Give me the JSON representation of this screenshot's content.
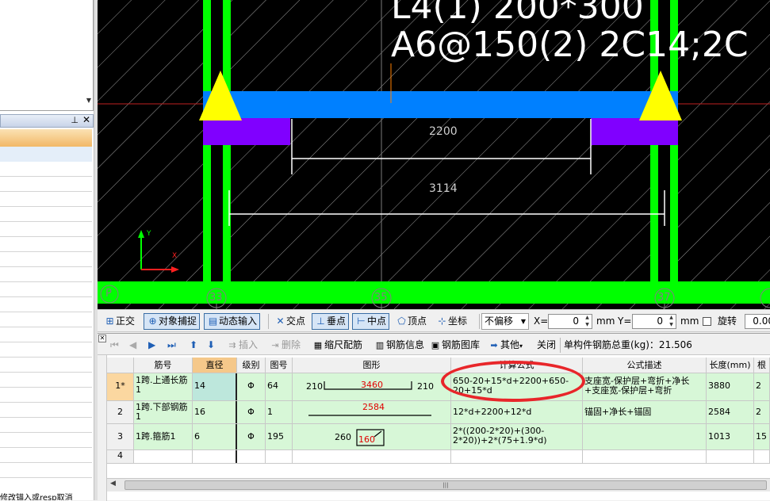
{
  "cad": {
    "line1": "L4(1) 200*300",
    "line2": "A6@150(2) 2C14;2C",
    "dim_inner": "2200",
    "dim_outer": "3114",
    "axis_y": "Y",
    "axis_x": "X",
    "grid_p": "P",
    "grid_33": "33",
    "grid_35": "35",
    "grid_37": "37"
  },
  "toolbar": {
    "ortho": "正交",
    "snap": "对象捕捉",
    "dynamic": "动态输入",
    "intersect": "交点",
    "perp": "垂点",
    "mid": "中点",
    "vertex": "顶点",
    "coord": "坐标",
    "offset": "不偏移",
    "x_label": "X=",
    "x_value": "0",
    "mm1": "mm",
    "y_label": "Y=",
    "y_value": "0",
    "mm2": "mm",
    "rotate": "旋转",
    "rotate_value": "0.00"
  },
  "rebar_toolbar": {
    "insert": "插入",
    "delete": "删除",
    "scale": "缩尺配筋",
    "info": "钢筋信息",
    "library": "钢筋图库",
    "other": "其他",
    "close": "关闭",
    "total": "单构件钢筋总重(kg)：21.506"
  },
  "table": {
    "headers": [
      "筋号",
      "直径(mm)",
      "级别",
      "图号",
      "图形",
      "计算公式",
      "公式描述",
      "长度(mm)",
      "根数"
    ],
    "rows": [
      {
        "idx": "1*",
        "name": "1跨.上通长筋1",
        "dia": "14",
        "grade": "Φ",
        "fig": "64",
        "shape_left": "210",
        "shape_mid": "3460",
        "shape_right": "210",
        "formula": "650-20+15*d+2200+650-20+15*d",
        "desc": "支座宽-保护层+弯折+净长+支座宽-保护层+弯折",
        "len": "3880",
        "count": "2"
      },
      {
        "idx": "2",
        "name": "1跨.下部钢筋1",
        "dia": "16",
        "grade": "Φ",
        "fig": "1",
        "shape_mid": "2584",
        "formula": "12*d+2200+12*d",
        "desc": "锚固+净长+锚固",
        "len": "2584",
        "count": "2"
      },
      {
        "idx": "3",
        "name": "1跨.箍筋1",
        "dia": "6",
        "grade": "Φ",
        "fig": "195",
        "shape_left": "260",
        "shape_mid": "160",
        "formula": "2*((200-2*20)+(300-2*20))+2*(75+1.9*d)",
        "desc": "",
        "len": "1013",
        "count": "15"
      },
      {
        "idx": "4"
      }
    ]
  },
  "left_status": "修改锚入或resp取消"
}
